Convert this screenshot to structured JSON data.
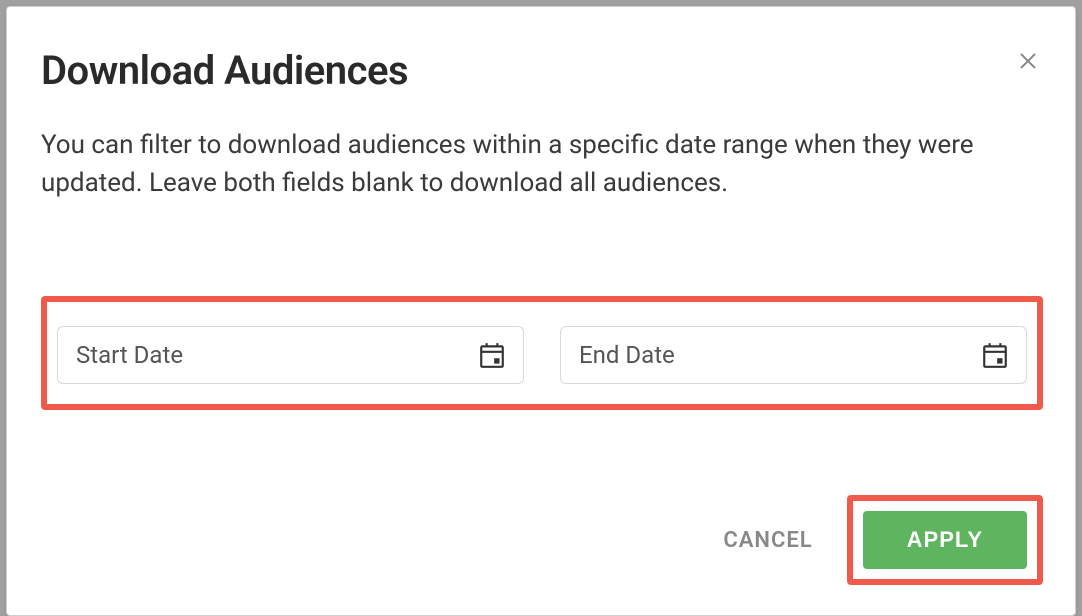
{
  "modal": {
    "title": "Download Audiences",
    "description": "You can filter to download audiences within a specific date range when they were updated. Leave both fields blank to download all audiences.",
    "start_date_placeholder": "Start Date",
    "end_date_placeholder": "End Date",
    "cancel_label": "CANCEL",
    "apply_label": "APPLY"
  },
  "highlight_color": "#f05a4a",
  "apply_button_color": "#5fb45f"
}
